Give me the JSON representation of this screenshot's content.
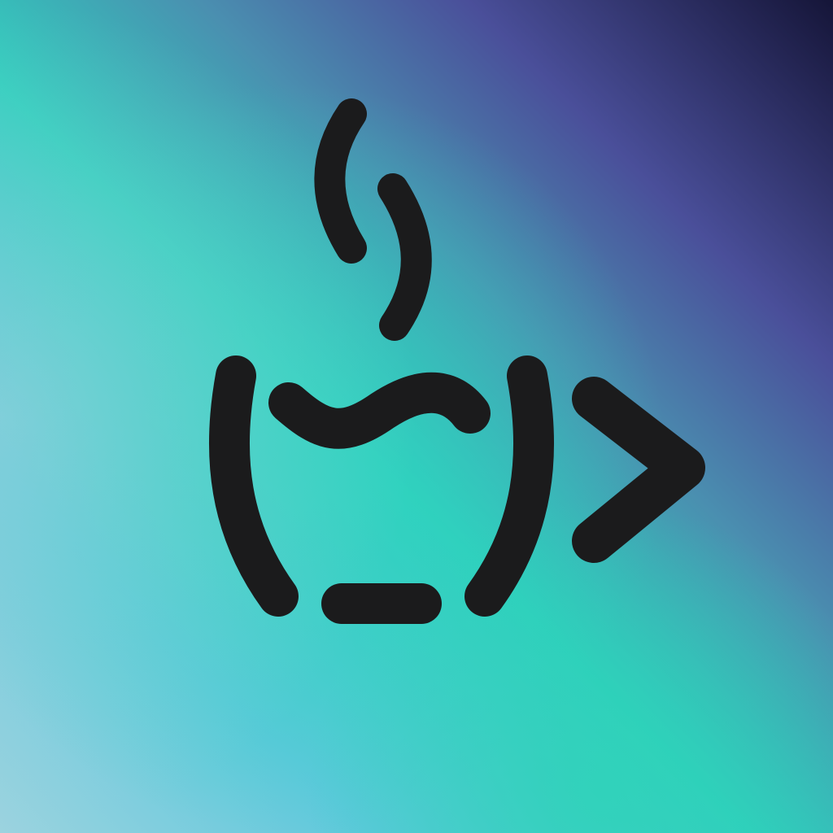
{
  "app_icon": {
    "name": "coffee-cup-terminal-logo",
    "icons": [
      "steam-icon",
      "coffee-cup-icon",
      "prompt-chevron-icon"
    ],
    "colors": {
      "glyph": "#1b1b1c",
      "bg_teal": "#2fcfbd",
      "bg_sky": "#5ec8dc",
      "bg_light": "#9cd3df",
      "bg_purple": "#4a4f9a",
      "bg_navy": "#151538"
    }
  }
}
